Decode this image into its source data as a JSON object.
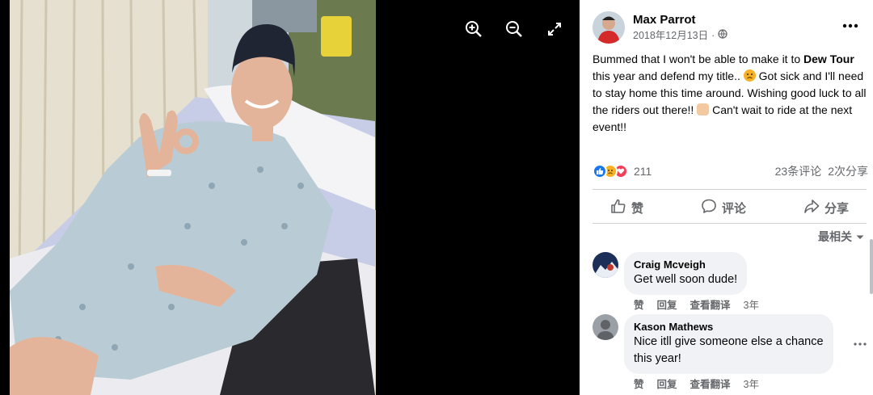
{
  "viewer": {
    "zoom_in_icon": "zoom-in-icon",
    "zoom_out_icon": "zoom-out-icon",
    "fullscreen_icon": "fullscreen-icon"
  },
  "post": {
    "author": "Max Parrot",
    "date": "2018年12月13日",
    "sep": "·",
    "text_part1": "Bummed that I won't be able to make it to ",
    "text_bold": "Dew Tour",
    "text_part2": " this year and defend my title.. ",
    "text_part3": " Got sick and I'll need to stay home this time around. Wishing good luck to all the riders out there!! ",
    "text_part4": " Can't wait to ride at the next event!!"
  },
  "stats": {
    "reaction_count": "211",
    "comments": "23条评论",
    "shares": "2次分享"
  },
  "actions": {
    "like": "赞",
    "comment": "评论",
    "share": "分享"
  },
  "sort_label": "最相关",
  "comments": [
    {
      "name": "Craig Mcveigh",
      "text": "Get well soon dude!",
      "like": "赞",
      "reply": "回复",
      "translate": "查看翻译",
      "age": "3年"
    },
    {
      "name": "Kason Mathews",
      "text_line1": "Nice itll give someone else a chance",
      "text_line2": "this year!",
      "like": "赞",
      "reply": "回复",
      "translate": "查看翻译",
      "age": "3年"
    }
  ],
  "colors": {
    "like_blue": "#1877f2",
    "love_red": "#f33e58",
    "sad_yellow": "#f7b125",
    "text_gray": "#65676b",
    "bubble_gray": "#f0f2f5"
  }
}
